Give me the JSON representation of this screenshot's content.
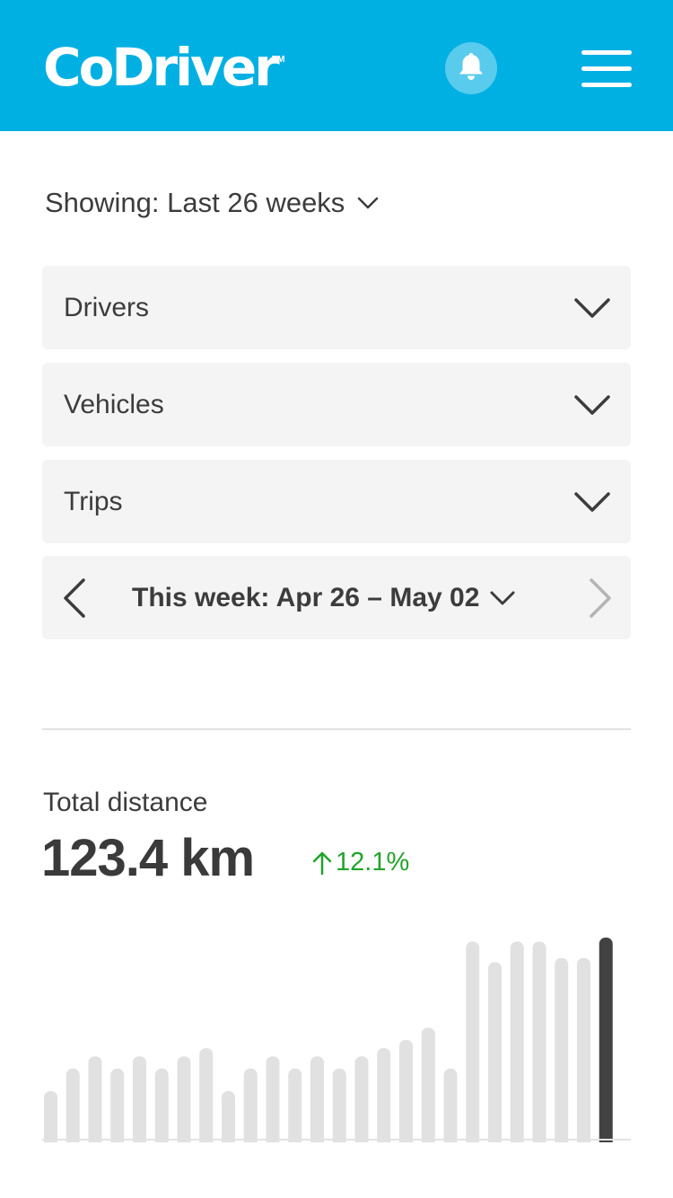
{
  "header": {
    "logo_text": "CoDriver",
    "logo_tm": "TM",
    "brand_color": "#00b0e3",
    "notification_icon": "bell-icon",
    "menu_icon": "hamburger-menu-icon"
  },
  "period": {
    "label": "Showing: Last 26 weeks"
  },
  "filters": [
    {
      "label": "Drivers"
    },
    {
      "label": "Vehicles"
    },
    {
      "label": "Trips"
    }
  ],
  "week_nav": {
    "label": "This week: Apr 26 – May 02"
  },
  "stats": {
    "title": "Total distance",
    "value": "123.4 km",
    "change": "12.1%",
    "change_direction": "up",
    "change_color": "#22a32b"
  },
  "chart_data": {
    "type": "bar",
    "title": "",
    "xlabel": "",
    "ylabel": "",
    "ylim": [
      0,
      100
    ],
    "grid": false,
    "highlight_color": "#424242",
    "bar_color": "#e1e1e1",
    "values": [
      25,
      36,
      42,
      36,
      42,
      36,
      42,
      46,
      25,
      36,
      42,
      36,
      42,
      36,
      42,
      46,
      50,
      56,
      36,
      98,
      88,
      98,
      98,
      90,
      90,
      100
    ],
    "highlight_index": 25
  }
}
